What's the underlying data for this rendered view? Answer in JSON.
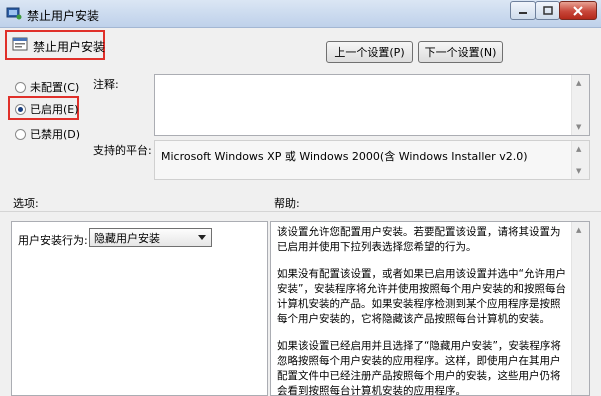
{
  "window": {
    "title": "禁止用户安装"
  },
  "header": {
    "policy_name": "禁止用户安装",
    "prev_button": "上一个设置(P)",
    "next_button": "下一个设置(N)"
  },
  "state": {
    "options": [
      {
        "label": "未配置(C)",
        "selected": false
      },
      {
        "label": "已启用(E)",
        "selected": true
      },
      {
        "label": "已禁用(D)",
        "selected": false
      }
    ]
  },
  "comment": {
    "label": "注释:",
    "value": ""
  },
  "platform": {
    "label": "支持的平台:",
    "value": "Microsoft Windows XP 或 Windows 2000(含 Windows Installer v2.0)"
  },
  "options_section": {
    "heading": "选项:",
    "behavior_label": "用户安装行为:",
    "behavior_value": "隐藏用户安装"
  },
  "help_section": {
    "heading": "帮助:",
    "paragraphs": [
      "该设置允许您配置用户安装。若要配置该设置，请将其设置为已启用并使用下拉列表选择您希望的行为。",
      "如果没有配置该设置，或者如果已启用该设置并选中“允许用户安装”，安装程序将允许并使用按照每个用户安装的和按照每台计算机安装的产品。如果安装程序检测到某个应用程序是按照每个用户安装的，它将隐藏该产品按照每台计算机的安装。",
      "如果该设置已经启用并且选择了“隐藏用户安装”，安装程序将忽略按照每个用户安装的应用程序。这样，即使用户在其用户配置文件中已经注册产品按照每个用户的安装，这些用户仍将会看到按照每台计算机安装的应用程序。"
    ]
  },
  "colors": {
    "highlight_box": "#e0302a",
    "close_button": "#c8473a"
  }
}
